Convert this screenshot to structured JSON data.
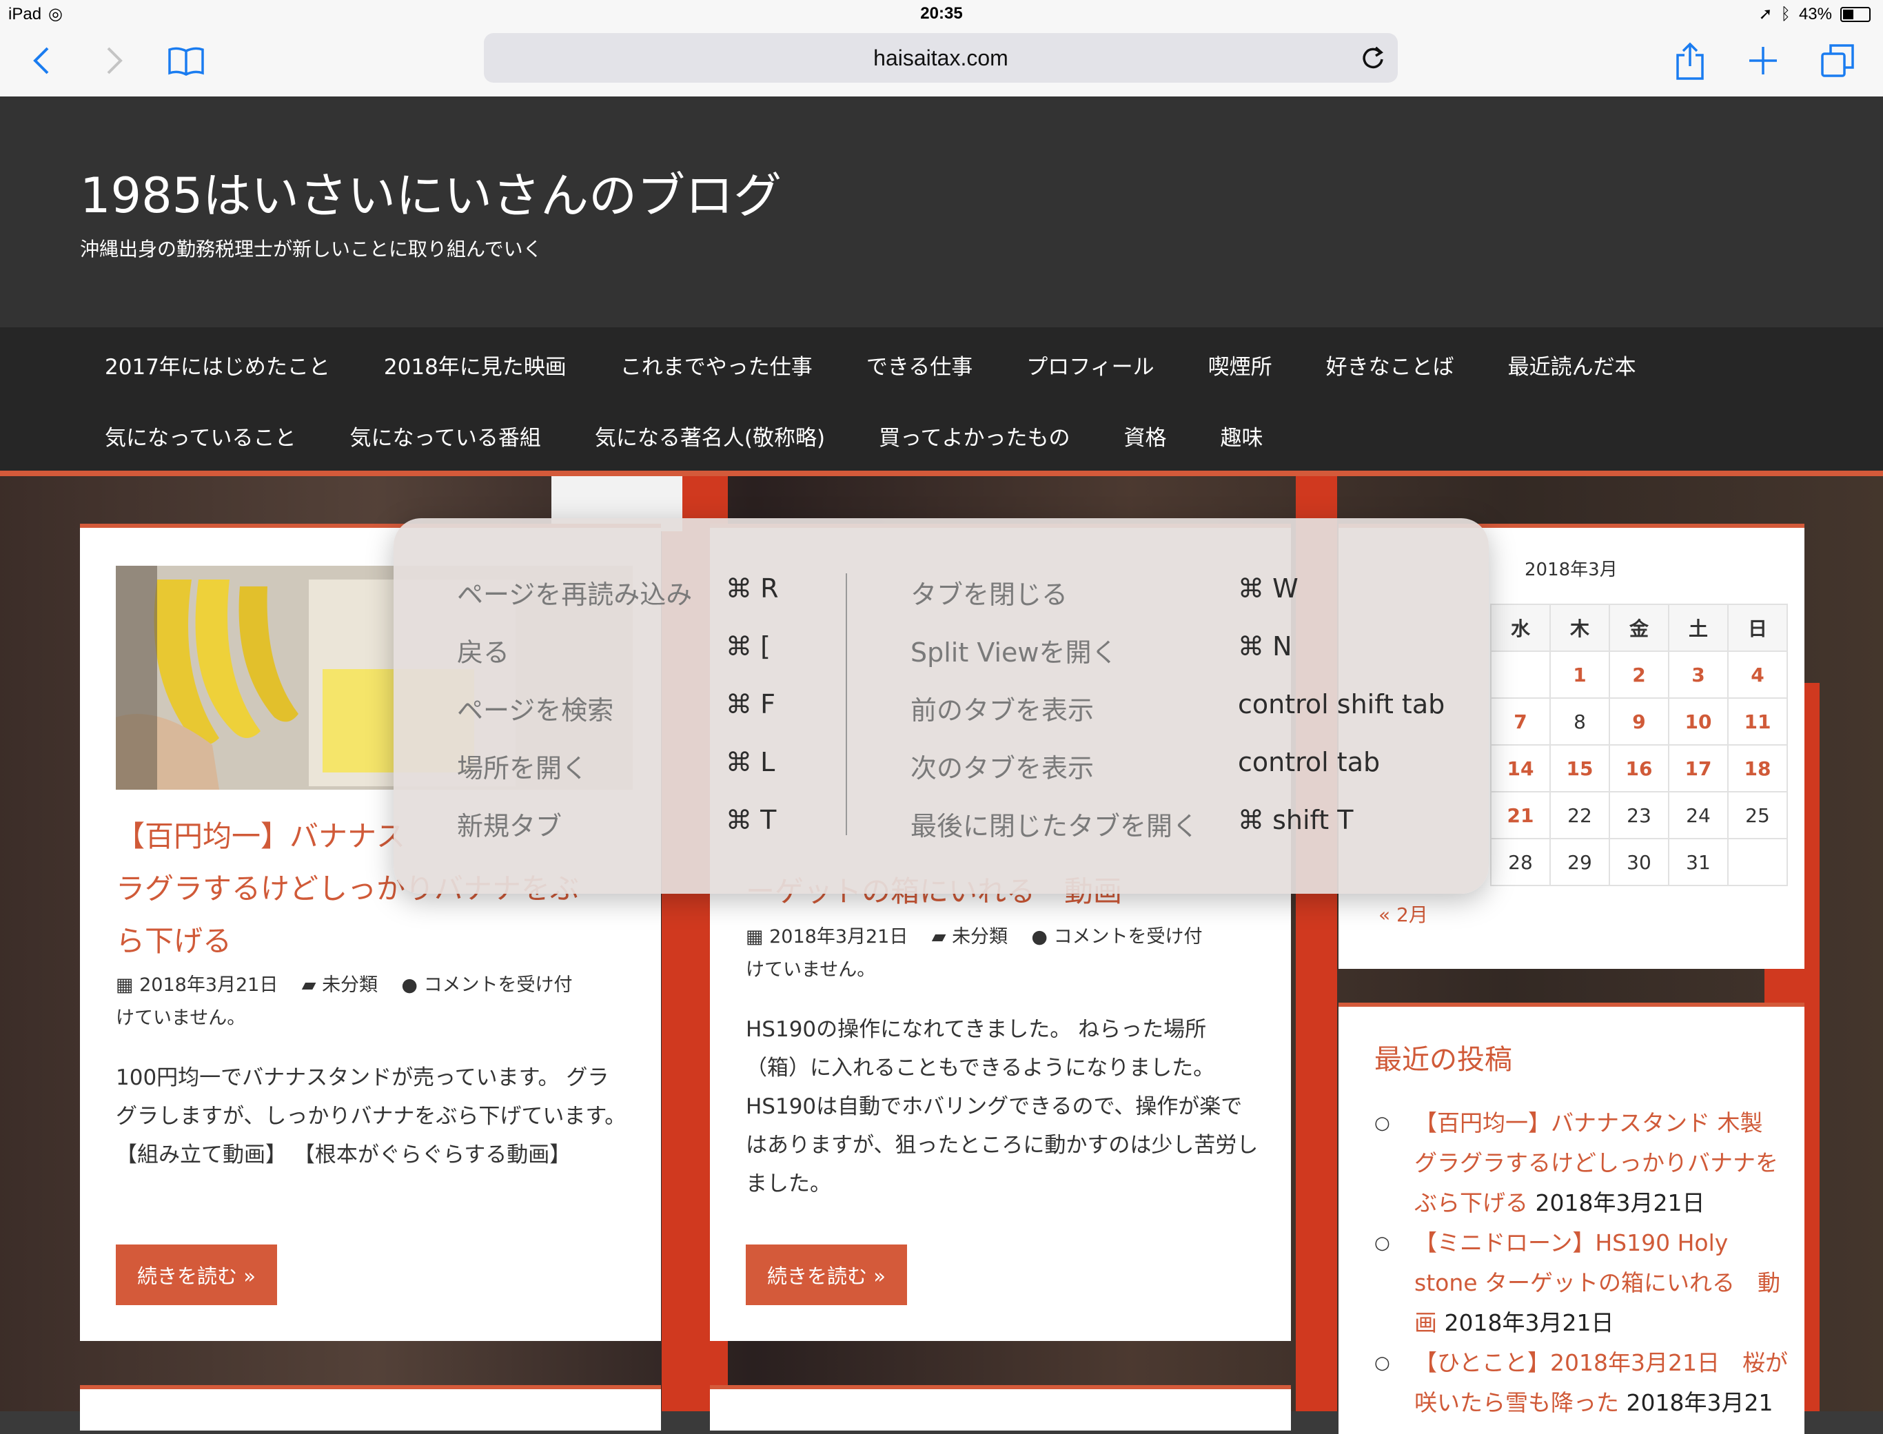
{
  "status_bar": {
    "device": "iPad",
    "time": "20:35",
    "battery": "43%",
    "battery_level": 0.43
  },
  "browser": {
    "url": "haisaitax.com"
  },
  "site": {
    "title": "1985はいさいにいさんのブログ",
    "description": "沖縄出身の勤務税理士が新しいことに取り組んでいく"
  },
  "nav": {
    "row1": [
      "2017年にはじめたこと",
      "2018年に見た映画",
      "これまでやった仕事",
      "できる仕事",
      "プロフィール",
      "喫煙所",
      "好きなことば",
      "最近読んだ本"
    ],
    "row2": [
      "気になっていること",
      "気になっている番組",
      "気になる著名人(敬称略)",
      "買ってよかったもの",
      "資格",
      "趣味"
    ]
  },
  "posts": [
    {
      "title": "【百円均一】バナナス",
      "title_line2": "ラグラするけどしっかりバナナをぶ",
      "title_line3": "ら下げる",
      "date": "2018年3月21日",
      "category": "未分類",
      "comments": "コメントを受け付",
      "comments2": "けていません。",
      "excerpt": "100円均一でバナナスタンドが売っています。 グラグラしますが、しっかりバナナをぶら下げています。 【組み立て動画】 【根本がぐらぐらする動画】",
      "more": "続きを読む »",
      "thumb_label": "バナナスタンド"
    },
    {
      "title": "ーゲットの箱にいれる　動画",
      "date": "2018年3月21日",
      "category": "未分類",
      "comments": "コメントを受け付",
      "comments2": "けていません。",
      "excerpt": "HS190の操作になれてきました。 ねらった場所（箱）に入れることもできるようになりました。 HS190は自動でホバリングできるので、操作が楽ではありますが、狙ったところに動かすのは少し苦労しました。",
      "more": "続きを読む »"
    }
  ],
  "calendar": {
    "caption": "2018年3月",
    "headers": [
      "水",
      "木",
      "金",
      "土",
      "日"
    ],
    "rows": [
      [
        "",
        "1",
        "2",
        "3",
        "4"
      ],
      [
        "7",
        "8",
        "9",
        "10",
        "11"
      ],
      [
        "14",
        "15",
        "16",
        "17",
        "18"
      ],
      [
        "21",
        "22",
        "23",
        "24",
        "25"
      ],
      [
        "28",
        "29",
        "30",
        "31",
        ""
      ]
    ],
    "linked_days": [
      "1",
      "2",
      "3",
      "4",
      "7",
      "9",
      "10",
      "11",
      "14",
      "15",
      "16",
      "17",
      "18",
      "21"
    ],
    "prev": "« 2月"
  },
  "recent_posts": {
    "title": "最近の投稿",
    "items": [
      {
        "link": "【百円均一】バナナスタンド 木製 グラグラするけどしっかりバナナをぶら下げる",
        "date": "2018年3月21日"
      },
      {
        "link": "【ミニドローン】HS190 Holy stone ターゲットの箱にいれる　動画",
        "date": "2018年3月21日"
      },
      {
        "link": "【ひとこと】2018年3月21日　桜が咲いたら雪も降った",
        "date": "2018年3月21"
      }
    ]
  },
  "shortcuts": {
    "left": [
      {
        "label": "ページを再読み込み",
        "key": "⌘ R"
      },
      {
        "label": "戻る",
        "key": "⌘ ["
      },
      {
        "label": "ページを検索",
        "key": "⌘ F"
      },
      {
        "label": "場所を開く",
        "key": "⌘ L"
      },
      {
        "label": "新規タブ",
        "key": "⌘ T"
      }
    ],
    "right": [
      {
        "label": "タブを閉じる",
        "key": "⌘ W"
      },
      {
        "label": "Split Viewを開く",
        "key": "⌘ N"
      },
      {
        "label": "前のタブを表示",
        "key": "control shift tab"
      },
      {
        "label": "次のタブを表示",
        "key": "control tab"
      },
      {
        "label": "最後に閉じたタブを開く",
        "key": "⌘ shift T"
      }
    ]
  },
  "colors": {
    "accent": "#d45a3a",
    "header_bg": "#333333",
    "nav_bg": "#262626"
  }
}
